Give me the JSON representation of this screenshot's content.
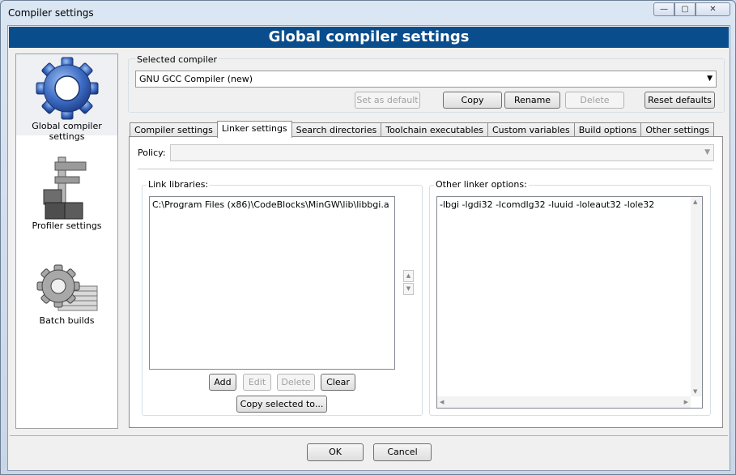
{
  "window": {
    "title": "Compiler settings",
    "min_glyph": "—",
    "max_glyph": "▢",
    "close_glyph": "✕"
  },
  "banner": "Global compiler settings",
  "sidebar": {
    "items": [
      {
        "label": "Global compiler settings",
        "icon": "gear-icon"
      },
      {
        "label": "Profiler settings",
        "icon": "caliper-icon"
      },
      {
        "label": "Batch builds",
        "icon": "gear-stack-icon"
      }
    ]
  },
  "compiler": {
    "label": "Selected compiler",
    "value": "GNU GCC Compiler (new)",
    "buttons": {
      "set_default": "Set as default",
      "copy": "Copy",
      "rename": "Rename",
      "delete": "Delete",
      "reset": "Reset defaults"
    }
  },
  "tabs": [
    "Compiler settings",
    "Linker settings",
    "Search directories",
    "Toolchain executables",
    "Custom variables",
    "Build options",
    "Other settings"
  ],
  "linker": {
    "policy_label": "Policy:",
    "policy_value": "",
    "link_libraries_label": "Link libraries:",
    "libraries": [
      "C:\\Program Files (x86)\\CodeBlocks\\MinGW\\lib\\libbgi.a"
    ],
    "lib_buttons": {
      "add": "Add",
      "edit": "Edit",
      "delete": "Delete",
      "clear": "Clear",
      "copy_to": "Copy selected to..."
    },
    "other_options_label": "Other linker options:",
    "other_options": "-lbgi -lgdi32 -lcomdlg32 -luuid -loleaut32 -lole32"
  },
  "dialog_buttons": {
    "ok": "OK",
    "cancel": "Cancel"
  },
  "colors": {
    "banner": "#0a4d8c",
    "accent": "#2f5fb0"
  }
}
